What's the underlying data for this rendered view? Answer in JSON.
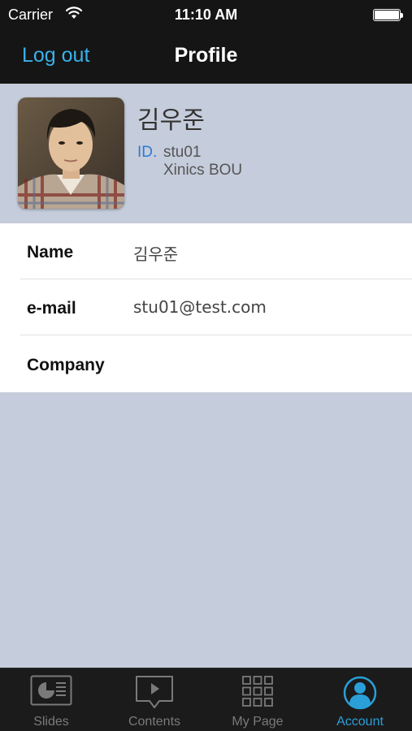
{
  "status_bar": {
    "carrier": "Carrier",
    "time": "11:10 AM"
  },
  "nav": {
    "logout_label": "Log out",
    "title": "Profile"
  },
  "profile": {
    "name": "김우준",
    "id_label": "ID.",
    "id_value": "stu01",
    "company": "Xinics BOU"
  },
  "info": {
    "rows": [
      {
        "label": "Name",
        "value": "김우준"
      },
      {
        "label": "e-mail",
        "value": "stu01@test.com"
      },
      {
        "label": "Company",
        "value": ""
      }
    ]
  },
  "tabbar": {
    "tabs": [
      {
        "label": "Slides",
        "icon": "slides-icon"
      },
      {
        "label": "Contents",
        "icon": "contents-icon"
      },
      {
        "label": "My Page",
        "icon": "grid-icon"
      },
      {
        "label": "Account",
        "icon": "account-icon"
      }
    ],
    "active_index": 3
  },
  "colors": {
    "accent": "#3ab1ea",
    "tab_active": "#2a9fd8",
    "background": "#c5ccdb",
    "bar": "#151515"
  }
}
